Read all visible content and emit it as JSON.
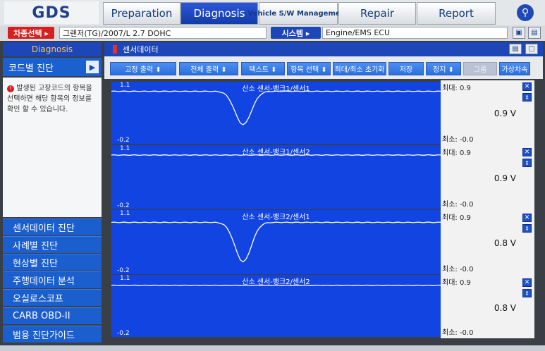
{
  "app": {
    "logo": "GDS"
  },
  "nav": {
    "tabs": [
      {
        "label": "Preparation"
      },
      {
        "label": "Diagnosis"
      },
      {
        "label": "Vehicle S/W Management"
      },
      {
        "label": "Repair"
      },
      {
        "label": "Report"
      }
    ],
    "search_icon": "search-icon"
  },
  "vehicle_bar": {
    "select_label": "차종선택 ▸",
    "vehicle_value": "그랜저(TG)/2007/L 2.7 DOHC",
    "system_label": "시스템 ▸",
    "system_value": "Engine/EMS ECU"
  },
  "left_panel": {
    "header": "Diagnosis",
    "sub_label": "코드별 진단",
    "info_text": "발생된 고장코드의 항목을 선택하면 해당 항목의 정보를 확인 할 수 있습니다.",
    "menu": [
      "센서데이터 진단",
      "사례별 진단",
      "현상별 진단",
      "주행데이터 분석",
      "오실로스코프",
      "CARB OBD-II",
      "범용 진단가이드"
    ]
  },
  "main_panel": {
    "header": "센서데이터",
    "toolbar": [
      {
        "label": "고정 출력 ⬍",
        "enabled": true
      },
      {
        "label": "전체 출력 ⬍",
        "enabled": true
      },
      {
        "label": "텍스트 ⬍",
        "enabled": true
      },
      {
        "label": "항목 선택 ⬍",
        "enabled": true
      },
      {
        "label": "최대/최소 초기화",
        "enabled": true
      },
      {
        "label": "저장",
        "enabled": true
      },
      {
        "label": "정지 ⬍",
        "enabled": true
      },
      {
        "label": "그룹",
        "enabled": false
      },
      {
        "label": "가상차속",
        "enabled": true
      }
    ]
  },
  "graphs": [
    {
      "title": "산소 센서-뱅크1/센서1",
      "ymax": "1.1",
      "ymin": "-0.2",
      "max": "최대: 0.9",
      "min": "최소: -0.0",
      "current": "0.9 V",
      "baseline": 0.9,
      "dip": 0.2
    },
    {
      "title": "산소 센서-뱅크1/센서2",
      "ymax": "1.1",
      "ymin": "-0.2",
      "max": "최대: 0.9",
      "min": "최소: -0.0",
      "current": "0.9 V",
      "baseline": 0.9,
      "dip": 0.9
    },
    {
      "title": "산소 센서-뱅크2/센서1",
      "ymax": "1.1",
      "ymin": "-0.2",
      "max": "최대: 0.9",
      "min": "최소: -0.0",
      "current": "0.8 V",
      "baseline": 0.85,
      "dip": 0.05
    },
    {
      "title": "산소 센서-뱅크2/센서2",
      "ymax": "1.1",
      "ymin": "-0.2",
      "max": "최대: 0.9",
      "min": "최소: -0.0",
      "current": "0.8 V",
      "baseline": 0.88,
      "dip": 0.88
    }
  ]
}
